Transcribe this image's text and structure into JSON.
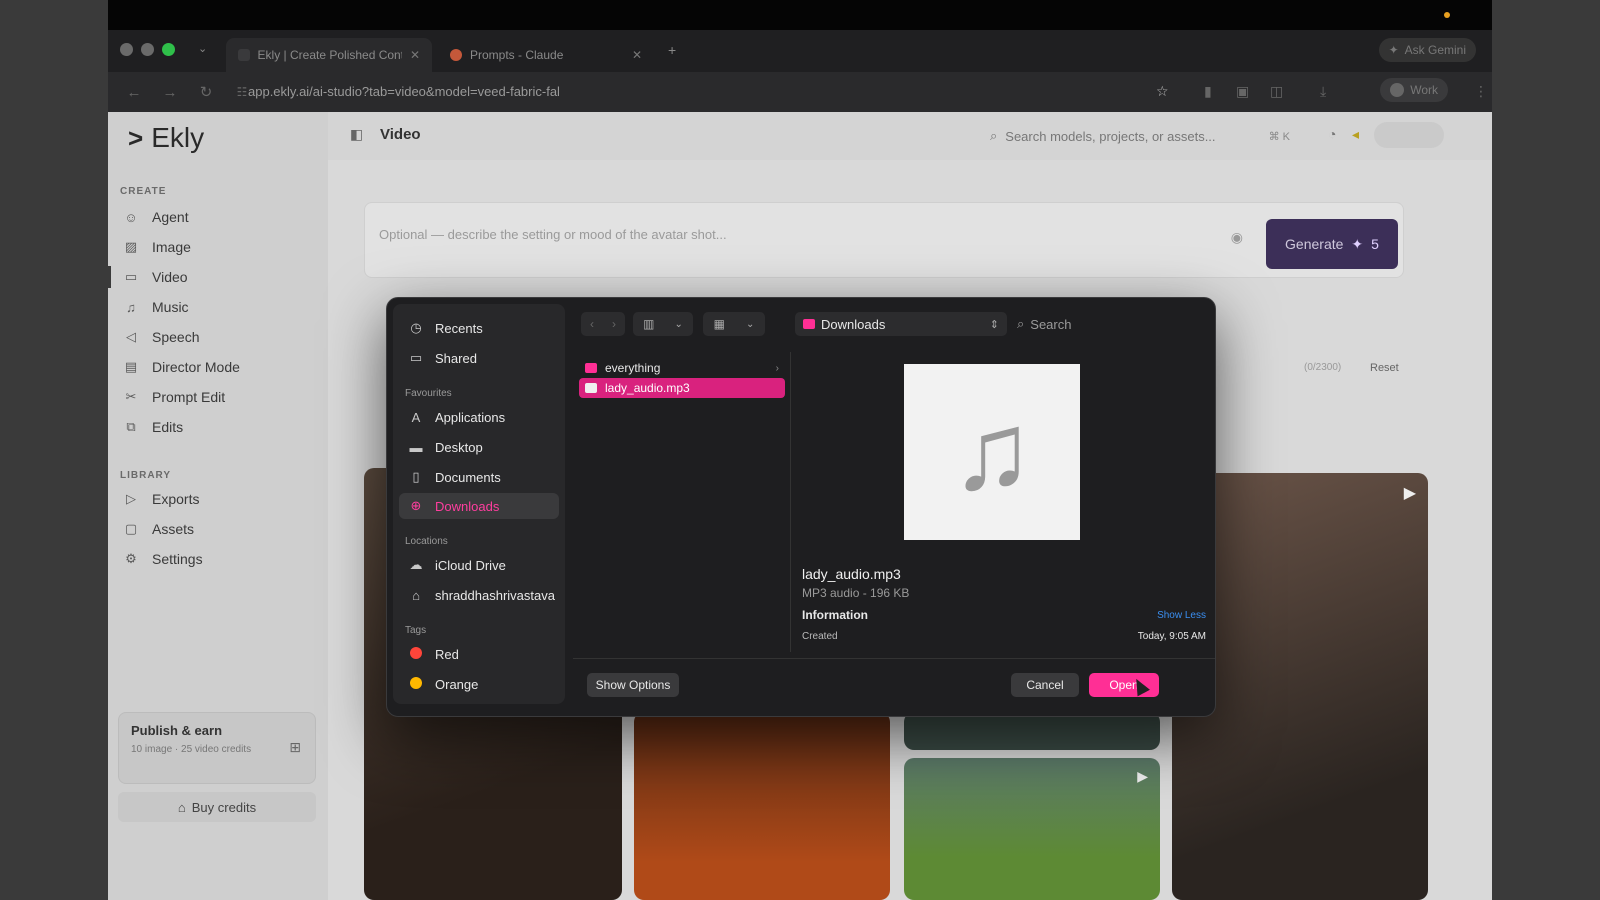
{
  "browser": {
    "tabs": [
      {
        "title": "Ekly | Create Polished Conten",
        "active": true
      },
      {
        "title": "Prompts - Claude",
        "active": false
      }
    ],
    "url": "app.ekly.ai/ai-studio?tab=video&model=veed-fabric-fal",
    "ask_label": "Ask Gemini",
    "profile_label": "Work"
  },
  "sidebar": {
    "brand": "Ekly",
    "create_heading": "CREATE",
    "create_items": [
      {
        "label": "Agent",
        "icon": "robot-icon"
      },
      {
        "label": "Image",
        "icon": "image-icon"
      },
      {
        "label": "Video",
        "icon": "video-icon",
        "active": true
      },
      {
        "label": "Music",
        "icon": "music-icon"
      },
      {
        "label": "Speech",
        "icon": "speaker-icon"
      },
      {
        "label": "Director Mode",
        "icon": "clapper-icon"
      },
      {
        "label": "Prompt Edit",
        "icon": "scissors-icon"
      },
      {
        "label": "Edits",
        "icon": "layers-icon"
      }
    ],
    "library_heading": "LIBRARY",
    "library_items": [
      {
        "label": "Exports",
        "icon": "play-icon"
      },
      {
        "label": "Assets",
        "icon": "box-icon"
      },
      {
        "label": "Settings",
        "icon": "gear-icon"
      }
    ],
    "publish": {
      "title": "Publish & earn",
      "subtitle": "10 image · 25 video credits"
    },
    "buy_credits": "Buy credits"
  },
  "header": {
    "title": "Video",
    "search_placeholder": "Search models, projects, or assets...",
    "shortcut": "⌘ K"
  },
  "composer": {
    "placeholder": "Optional — describe the setting or mood of the avatar shot...",
    "generate_label": "Generate",
    "generate_cost": "5",
    "char_count": "(0/2300)",
    "reset_label": "Reset"
  },
  "file_dialog": {
    "sidebar": {
      "top_items": [
        {
          "label": "Recents",
          "icon": "clock-icon"
        },
        {
          "label": "Shared",
          "icon": "shared-folder-icon"
        }
      ],
      "favourites_heading": "Favourites",
      "favourites": [
        {
          "label": "Applications",
          "icon": "apps-icon"
        },
        {
          "label": "Desktop",
          "icon": "desktop-icon"
        },
        {
          "label": "Documents",
          "icon": "document-icon"
        },
        {
          "label": "Downloads",
          "icon": "download-icon",
          "active": true
        }
      ],
      "locations_heading": "Locations",
      "locations": [
        {
          "label": "iCloud Drive",
          "icon": "cloud-icon"
        },
        {
          "label": "shraddhashrivastava",
          "icon": "home-icon"
        }
      ],
      "tags_heading": "Tags",
      "tags": [
        {
          "label": "Red",
          "color": "#ff453a"
        },
        {
          "label": "Orange",
          "color": "#ffb800"
        }
      ]
    },
    "location": "Downloads",
    "search_placeholder": "Search",
    "files": [
      {
        "name": "everything",
        "kind": "folder",
        "selected": false
      },
      {
        "name": "lady_audio.mp3",
        "kind": "file",
        "selected": true
      }
    ],
    "preview": {
      "name": "lady_audio.mp3",
      "meta": "MP3 audio - 196 KB",
      "info_heading": "Information",
      "show_less": "Show Less",
      "created_label": "Created",
      "created_value": "Today, 9:05 AM"
    },
    "show_options": "Show Options",
    "cancel": "Cancel",
    "open": "Open"
  },
  "colors": {
    "accent": "#ff2f95",
    "selection": "#d9227e",
    "generate_bg": "#3c2f58"
  }
}
